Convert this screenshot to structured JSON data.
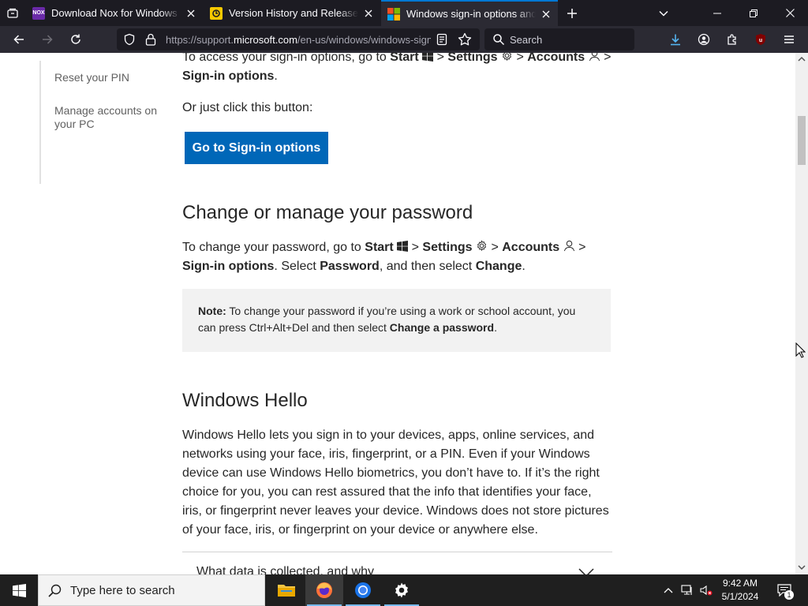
{
  "browser": {
    "tabs": [
      {
        "title": "Download Nox for Windows PC",
        "favicon_text": "NOX",
        "favicon_color": "#6a2aa8",
        "active": false
      },
      {
        "title": "Version History and Release Notes",
        "favicon_text": "",
        "favicon_color": "#f7c900",
        "active": false
      },
      {
        "title": "Windows sign-in options and account protection",
        "favicon_text": "",
        "favicon_color": "#f25022",
        "active": true
      }
    ],
    "url_prefix": "https://support.",
    "url_domain": "microsoft.com",
    "url_suffix": "/en-us/windows/windows-sign-in-options",
    "search_placeholder": "Search",
    "extension_badge": "3"
  },
  "sidenav": {
    "items": [
      "Reset your PIN",
      "Manage accounts on your PC"
    ]
  },
  "content": {
    "intro": {
      "pre": "To access your sign-in options, go to",
      "start": "Start",
      "settings": "Settings",
      "accounts": "Accounts",
      "signin": "Sign-in options",
      "end": ".",
      "sep": ">"
    },
    "or_click": "Or just click this button:",
    "cta_label": "Go to Sign-in options",
    "heading_password": "Change or manage your password",
    "password_para": {
      "pre": "To change your password, go to",
      "start": "Start",
      "settings": "Settings",
      "accounts": "Accounts",
      "signin": "Sign-in options",
      "mid1": ". Select",
      "password": "Password",
      "mid2": ", and then select",
      "change": "Change",
      "end": ".",
      "sep": ">"
    },
    "note": {
      "label": "Note:",
      "text1": "To change your password if you’re using a work or school account, you can press Ctrl+Alt+Del and then select",
      "bold": "Change a password",
      "end": "."
    },
    "heading_hello": "Windows Hello",
    "hello_para": "Windows Hello lets you sign in to your devices, apps, online services, and networks using your face, iris, fingerprint, or a PIN. Even if your Windows device can use Windows Hello biometrics, you don’t have to. If it’s the right choice for you, you can rest assured that the info that identifies your face, iris, or fingerprint never leaves your device. Windows does not store pictures of your face, iris, or fingerprint on your device or anywhere else.",
    "accordion_label": "What data is collected, and why"
  },
  "taskbar": {
    "search_placeholder": "Type here to search",
    "time": "9:42 AM",
    "date": "5/1/2024",
    "notification_count": "1"
  },
  "colors": {
    "accent": "#0067b8",
    "tab_active_border": "#0078d4"
  }
}
